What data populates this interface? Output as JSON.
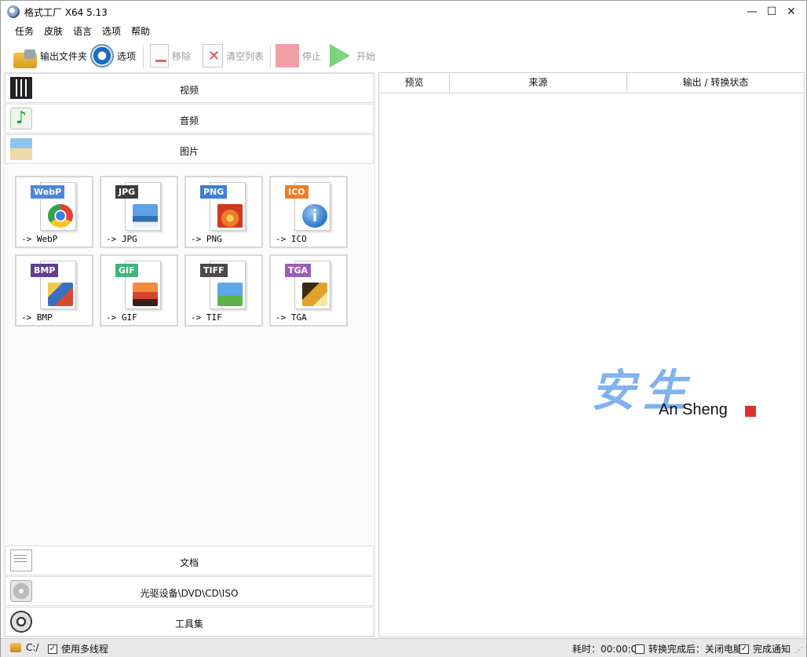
{
  "window": {
    "title": "格式工厂 X64 5.13",
    "min": "—",
    "max": "☐",
    "close": "✕"
  },
  "menu": [
    "任务",
    "皮肤",
    "语言",
    "选项",
    "帮助"
  ],
  "toolbar": {
    "output_folder": "输出文件夹",
    "options": "选项",
    "remove": "移除",
    "clear_list": "清空列表",
    "stop": "停止",
    "start": "开始"
  },
  "categories_top": [
    {
      "label": "视频",
      "icon": "video-icon"
    },
    {
      "label": "音频",
      "icon": "audio-icon"
    },
    {
      "label": "图片",
      "icon": "image-icon"
    }
  ],
  "formats": [
    {
      "badge": "WebP",
      "label": "-> WebP",
      "badge_color": "#4a86e0",
      "pic": "chrome"
    },
    {
      "badge": "JPG",
      "label": "-> JPG",
      "badge_color": "#3c3c3c",
      "pic": "landscape"
    },
    {
      "badge": "PNG",
      "label": "-> PNG",
      "badge_color": "#3d7fd6",
      "pic": "flower"
    },
    {
      "badge": "ICO",
      "label": "-> ICO",
      "badge_color": "#f07c2a",
      "pic": "info"
    },
    {
      "badge": "BMP",
      "label": "-> BMP",
      "badge_color": "#5d3e8f",
      "pic": "paint"
    },
    {
      "badge": "GIF",
      "label": "-> GIF",
      "badge_color": "#3fb67a",
      "pic": "sunset"
    },
    {
      "badge": "TIFF",
      "label": "-> TIF",
      "badge_color": "#4a4a4a",
      "pic": "meadow"
    },
    {
      "badge": "TGA",
      "label": "-> TGA",
      "badge_color": "#9b5db5",
      "pic": "autumn"
    }
  ],
  "categories_bottom": [
    {
      "label": "文档",
      "icon": "document-icon"
    },
    {
      "label": "光驱设备\\DVD\\CD\\ISO",
      "icon": "disc-icon"
    },
    {
      "label": "工具集",
      "icon": "tools-icon"
    }
  ],
  "list_columns": [
    "预览",
    "来源",
    "输出 / 转换状态"
  ],
  "watermark": {
    "cn": "安生",
    "en": "An Sheng"
  },
  "status": {
    "drive": "C:/",
    "multithread_label": "使用多线程",
    "multithread_checked": true,
    "elapsed": "耗时：00:00:00",
    "after_done_label": "转换完成后：关闭电脑",
    "after_done_checked": false,
    "notify_label": "完成通知",
    "notify_checked": true
  }
}
